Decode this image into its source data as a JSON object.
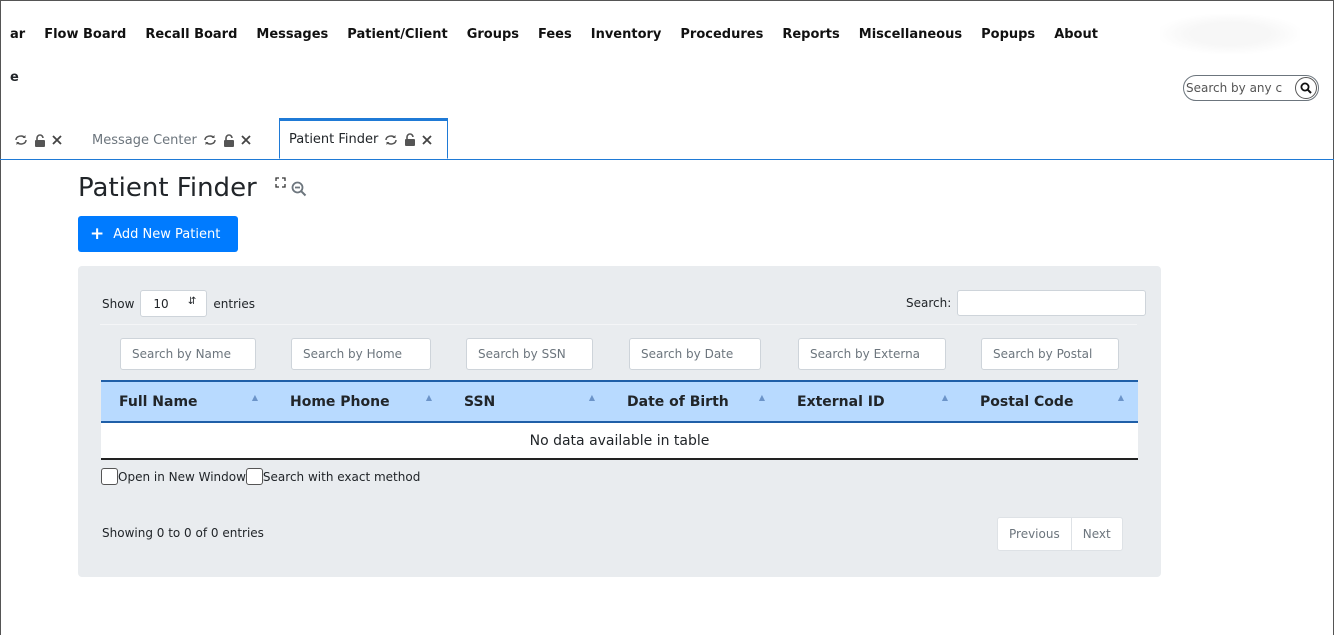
{
  "menu": {
    "items": [
      "ar",
      "Flow Board",
      "Recall Board",
      "Messages",
      "Patient/Client",
      "Groups",
      "Fees",
      "Inventory",
      "Procedures",
      "Reports",
      "Miscellaneous",
      "Popups",
      "About"
    ],
    "row2_letter": "e"
  },
  "global_search": {
    "placeholder": "Search by any c"
  },
  "tabs": [
    {
      "label": "",
      "active": false
    },
    {
      "label": "Message Center",
      "active": false
    },
    {
      "label": "Patient Finder",
      "active": true
    }
  ],
  "page": {
    "title": "Patient Finder",
    "add_button": "Add New Patient"
  },
  "table_controls": {
    "show_label": "Show",
    "entries_label": "entries",
    "length_value": "10",
    "search_label": "Search:"
  },
  "filters": [
    "Search by Name",
    "Search by Home",
    "Search by SSN",
    "Search by Date",
    "Search by Externa",
    "Search by Postal"
  ],
  "columns": [
    "Full Name",
    "Home Phone",
    "SSN",
    "Date of Birth",
    "External ID",
    "Postal Code"
  ],
  "empty_message": "No data available in table",
  "options": {
    "new_window": "Open in New Window",
    "exact_method": "Search with exact method"
  },
  "footer": {
    "info": "Showing 0 to 0 of 0 entries",
    "previous": "Previous",
    "next": "Next"
  },
  "colors": {
    "primary": "#007bff",
    "header_bg": "#b8daff",
    "panel_bg": "#e9ecef",
    "tab_accent": "#1f7ad6"
  }
}
